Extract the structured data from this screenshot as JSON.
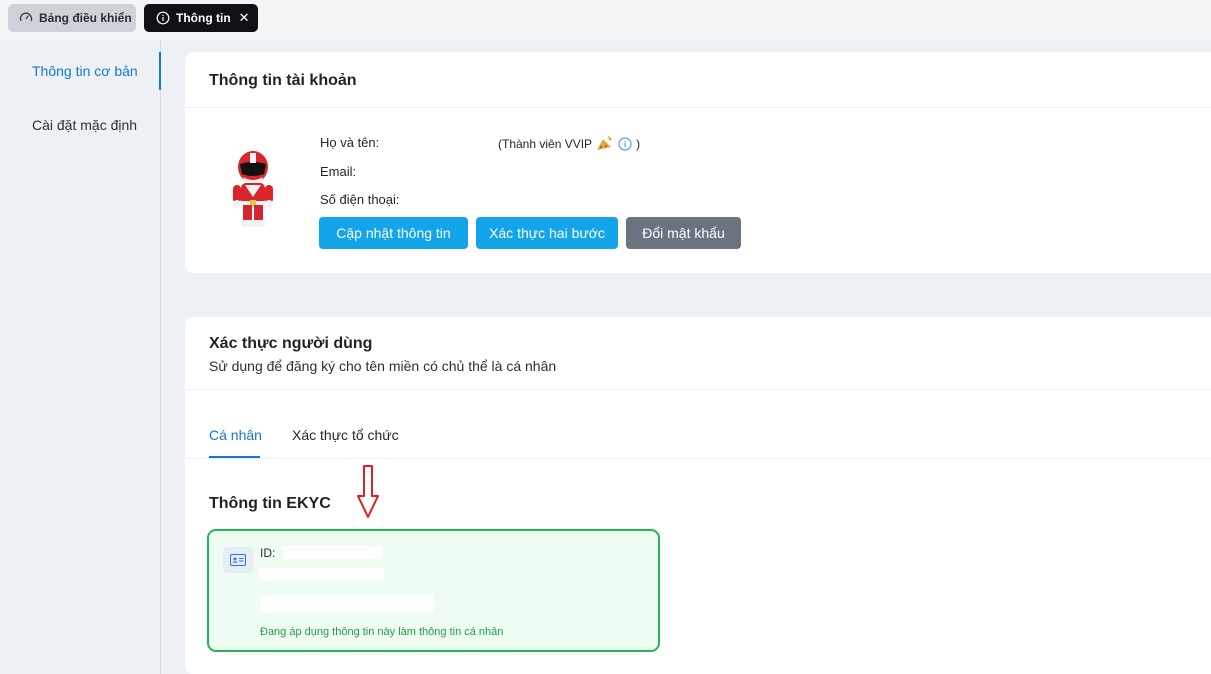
{
  "tabs": {
    "dashboard_label": "Bảng điều khiển",
    "info_label": "Thông tin",
    "close_symbol": "✕"
  },
  "sidebar": {
    "items": [
      {
        "label": "Thông tin cơ bản",
        "active": true
      },
      {
        "label": "Cài đặt mặc định",
        "active": false
      }
    ]
  },
  "account": {
    "title": "Thông tin tài khoản",
    "name_label": "Họ và tên:",
    "email_label": "Email:",
    "phone_label": "Số điện thoại:",
    "membership_open": "(Thành viên VVIP",
    "membership_close": ")",
    "buttons": {
      "update": "Cập nhật thông tin",
      "two_factor": "Xác thực hai bước",
      "change_password": "Đổi mật khẩu"
    }
  },
  "verification": {
    "title": "Xác thực người dùng",
    "subtitle": "Sử dụng để đăng ký cho tên miền có chủ thể là cá nhân",
    "tabs": [
      {
        "label": "Cá nhân",
        "active": true
      },
      {
        "label": "Xác thực tổ chức",
        "active": false
      }
    ],
    "ekyc_title": "Thông tin EKYC",
    "id_label": "ID:",
    "status_note": "Đang áp dụng thông tin này làm thông tin cá nhân"
  },
  "colors": {
    "primary_blue": "#13a5e9",
    "link_blue": "#1677d2",
    "gray_button": "#6b7280",
    "success_green": "#22b559",
    "annotation_red": "#e02020"
  }
}
